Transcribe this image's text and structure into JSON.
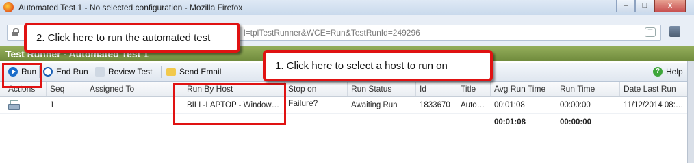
{
  "window": {
    "title": "Automated Test 1 - No selected configuration - Mozilla Firefox",
    "controls": {
      "minimize": "–",
      "maximize": "□",
      "close": "x"
    }
  },
  "address_bar": {
    "url_visible": "l=tplTestRunner&WCE=Run&TestRunId=249296"
  },
  "banner": {
    "text": "Test Runner - Automated Test 1"
  },
  "toolbar": {
    "run_label": "Run",
    "end_run_label": "End Run",
    "review_test_label": "Review Test",
    "send_email_label": "Send Email",
    "help_label": "Help"
  },
  "table": {
    "columns": [
      "Actions",
      "Seq",
      "Assigned To",
      "Run By Host",
      "Stop on Failure?",
      "Run Status",
      "Id",
      "Title",
      "Avg Run Time",
      "Run Time",
      "Date Last Run"
    ],
    "rows": [
      {
        "seq": "1",
        "assigned_to": "",
        "run_by_host": "BILL-LAPTOP - Window…",
        "stop_on_failure": "",
        "run_status": "Awaiting Run",
        "id": "1833670",
        "title": "Auto…",
        "avg_run_time": "00:01:08",
        "run_time": "00:00:00",
        "date_last_run": "11/12/2014 08:…"
      }
    ],
    "totals": {
      "avg_run_time": "00:01:08",
      "run_time": "00:00:00"
    }
  },
  "annotations": {
    "callout_run": "2. Click here to run the automated test",
    "callout_host": "1. Click here to select a host to run on"
  },
  "colors": {
    "annotation_red": "#e01212",
    "banner_green": "#7d9a46",
    "toolbar_blue": "#1a6cc9"
  }
}
